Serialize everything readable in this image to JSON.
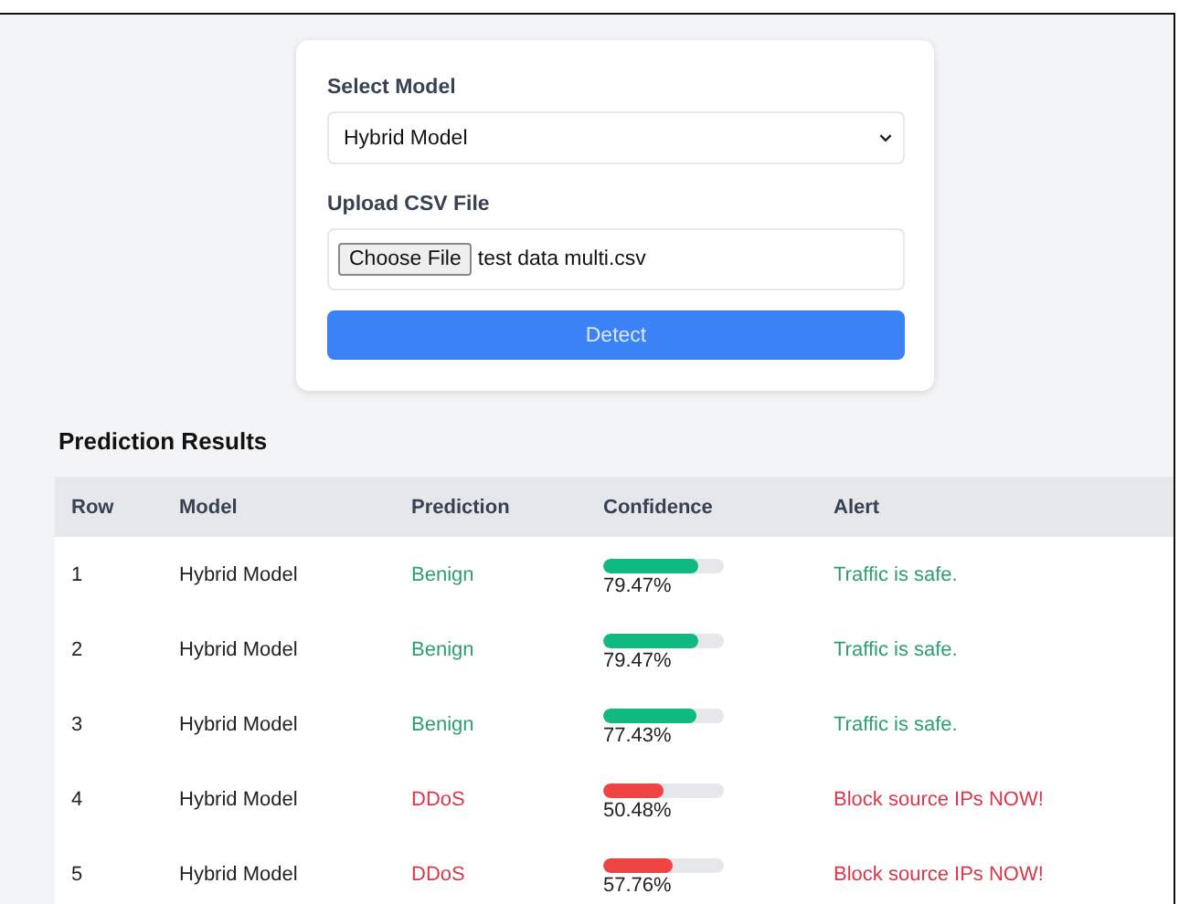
{
  "form": {
    "model_label": "Select Model",
    "model_value": "Hybrid Model",
    "file_label": "Upload CSV File",
    "file_button": "Choose File",
    "file_name": "test data multi.csv",
    "submit": "Detect"
  },
  "results": {
    "title": "Prediction Results",
    "columns": [
      "Row",
      "Model",
      "Prediction",
      "Confidence",
      "Alert"
    ],
    "rows": [
      {
        "row": "1",
        "model": "Hybrid Model",
        "prediction": "Benign",
        "kind": "benign",
        "level": 0.7947,
        "confidence": "79.47%",
        "alert": "Traffic is safe."
      },
      {
        "row": "2",
        "model": "Hybrid Model",
        "prediction": "Benign",
        "kind": "benign",
        "level": 0.7947,
        "confidence": "79.47%",
        "alert": "Traffic is safe."
      },
      {
        "row": "3",
        "model": "Hybrid Model",
        "prediction": "Benign",
        "kind": "benign",
        "level": 0.7743,
        "confidence": "77.43%",
        "alert": "Traffic is safe."
      },
      {
        "row": "4",
        "model": "Hybrid Model",
        "prediction": "DDoS",
        "kind": "attack",
        "level": 0.5048,
        "confidence": "50.48%",
        "alert": "Block source IPs NOW!"
      },
      {
        "row": "5",
        "model": "Hybrid Model",
        "prediction": "DDoS",
        "kind": "attack",
        "level": 0.5776,
        "confidence": "57.76%",
        "alert": "Block source IPs NOW!"
      }
    ]
  }
}
